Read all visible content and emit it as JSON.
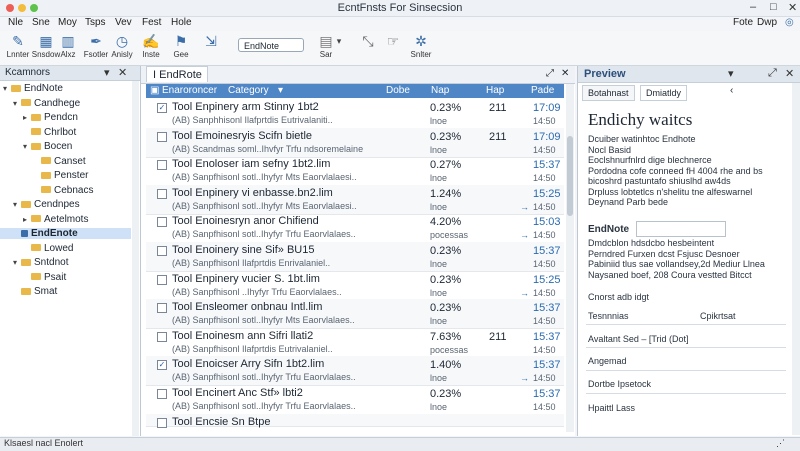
{
  "window": {
    "title": "EcntFnsts For Sinsecsion"
  },
  "menu": [
    "Nle",
    "Sne",
    "Moy",
    "Tsps",
    "Vev",
    "Fest",
    "Hole"
  ],
  "menu_right": [
    "Fote",
    "Dwp"
  ],
  "toolbar": {
    "buttons": [
      {
        "label": "Lnnter",
        "icon": "pin-icon"
      },
      {
        "label": "Snsdow",
        "icon": "grid-icon"
      },
      {
        "label": "Alxz",
        "icon": "book-icon"
      },
      {
        "label": "Fsotler",
        "icon": "pen-icon"
      },
      {
        "label": "Anisly",
        "icon": "clock-icon"
      },
      {
        "label": "Inste",
        "icon": "edit-icon"
      },
      {
        "label": "Gee",
        "icon": "flag-icon"
      }
    ],
    "select_value": "EndNote",
    "stack_label": "Sar",
    "tool_labels": [
      "",
      "Snlter"
    ]
  },
  "left_pane": {
    "title": "Kcamnors",
    "items": [
      {
        "label": "EndNote",
        "depth": 0,
        "toggle": "▾",
        "selected": false
      },
      {
        "label": "Candhege",
        "depth": 1,
        "toggle": "▾",
        "selected": false
      },
      {
        "label": "Pendcn",
        "depth": 2,
        "toggle": "▸",
        "selected": false
      },
      {
        "label": "Chrlbot",
        "depth": 2,
        "toggle": "",
        "selected": false
      },
      {
        "label": "Bocen",
        "depth": 2,
        "toggle": "▾",
        "selected": false
      },
      {
        "label": "Canset",
        "depth": 3,
        "toggle": "",
        "selected": false
      },
      {
        "label": "Penster",
        "depth": 3,
        "toggle": "",
        "selected": false
      },
      {
        "label": "Cebnacs",
        "depth": 3,
        "toggle": "",
        "selected": false
      },
      {
        "label": "Cendnpes",
        "depth": 1,
        "toggle": "▾",
        "selected": false
      },
      {
        "label": "Aetelmots",
        "depth": 2,
        "toggle": "▸",
        "selected": false
      },
      {
        "label": "EndEnote",
        "depth": 1,
        "toggle": "",
        "selected": true
      },
      {
        "label": "Lowed",
        "depth": 2,
        "toggle": "",
        "selected": false
      },
      {
        "label": "Sntdnot",
        "depth": 1,
        "toggle": "▾",
        "selected": false
      },
      {
        "label": "Psait",
        "depth": 2,
        "toggle": "",
        "selected": false
      },
      {
        "label": "Smat",
        "depth": 1,
        "toggle": "",
        "selected": false
      }
    ]
  },
  "center": {
    "tab": "I EndRote",
    "columns": [
      "Enaroroncer",
      "Category",
      "Dobe",
      "Nap",
      "Hap",
      "Pade"
    ],
    "rows": [
      {
        "checked": true,
        "title": "Tool Enpinery arm Stinny 1bt2",
        "sub": "(AB) Sanphhisonl Ilafprtdis Eutrivalaniti..",
        "pct": "0.23%",
        "status": "lnoe",
        "num": "211",
        "time": "17:09",
        "extra": "",
        "time2": "14:50"
      },
      {
        "checked": false,
        "title": "Tool Emoinesryis Scifn bietle",
        "sub": "(AB) Scandmas soml..Ihvfyr Trfu ndsoremelaine",
        "pct": "0.23%",
        "status": "lnoe",
        "num": "211",
        "time": "17:09",
        "extra": "",
        "time2": "14:50"
      },
      {
        "checked": false,
        "title": "Tool Enoloser iam sefny 1bt2.lim",
        "sub": "(AB) Sanpfhisonl sotl..Ihyfyr Mts Eaorvlalaesi..",
        "pct": "0.27%",
        "status": "lnoe",
        "num": "",
        "time": "15:37",
        "extra": "",
        "time2": "14:50"
      },
      {
        "checked": false,
        "title": "Tool Enpinery vi enbasse.bn2.lim",
        "sub": "(AB) Sanpfhisonl sotl..Ihyfyr Mts Eaorvlalaesi..",
        "pct": "1.24%",
        "status": "lnoe",
        "num": "",
        "time": "15:25",
        "extra": "→",
        "time2": "14:50"
      },
      {
        "checked": false,
        "title": "Tool Enoinesryn anor Chifiend",
        "sub": "(AB) Sanpfhisonl sotl..Ihyfyr Trfu Eaorvlalaes..",
        "pct": "4.20%",
        "status": "pocessas",
        "num": "",
        "time": "15:03",
        "extra": "→",
        "time2": "14:50"
      },
      {
        "checked": false,
        "title": "Tool Enoinery sine Sif» BU15",
        "sub": "(AB) Sanpfhisonl Ilafprtdis Enrivalaniel..",
        "pct": "0.23%",
        "status": "lnoe",
        "num": "",
        "time": "15:37",
        "extra": "",
        "time2": "14:50"
      },
      {
        "checked": false,
        "title": "Tool Enpinery vucier S. 1bt.lim",
        "sub": "(AB) Sanpfhisonl ..Ihyfyr Trfu Eaorvlalaes..",
        "pct": "0.23%",
        "status": "lnoe",
        "num": "",
        "time": "15:25",
        "extra": "→",
        "time2": "14:50"
      },
      {
        "checked": false,
        "title": "Tool Ensleomer onbnau Intl.lim",
        "sub": "(AB) Sanpfhisonl sotl..Ihyfyr Mts Eaorvlalaes..",
        "pct": "0.23%",
        "status": "lnoe",
        "num": "",
        "time": "15:37",
        "extra": "",
        "time2": "14:50"
      },
      {
        "checked": false,
        "title": "Tool Enoinesm ann Sifri llati2",
        "sub": "(AB) Sanpfhisonl Ilafprtdis Eutrivalaniel..",
        "pct": "7.63%",
        "status": "pocessas",
        "num": "211",
        "time": "15:37",
        "extra": "",
        "time2": "14:50"
      },
      {
        "checked": true,
        "title": "Tool Enoicser Arry Sifn 1bt2.lim",
        "sub": "(AB) Sanpfhisonl sotl..Ihyfyr Trfu Eaorvlalaes..",
        "pct": "1.40%",
        "status": "lnoe",
        "num": "",
        "time": "15:37",
        "extra": "→",
        "time2": "14:50"
      },
      {
        "checked": false,
        "title": "Tool Encinert Anc Stf» lbti2",
        "sub": "(AB) Sanpfhisonl sotl..Ihyfyr Trfu Eaorvlalaes..",
        "pct": "0.23%",
        "status": "lnoe",
        "num": "",
        "time": "15:37",
        "extra": "",
        "time2": "14:50"
      },
      {
        "checked": false,
        "title": "Tool Encsie Sn Btpe",
        "sub": "",
        "pct": "",
        "status": "",
        "num": "",
        "time": "",
        "extra": "",
        "time2": ""
      }
    ]
  },
  "right_pane": {
    "title": "Preview",
    "tabs": [
      "Botahnast",
      "Dmiatldy"
    ],
    "heading": "Endichy waitcs",
    "lines": [
      {
        "text": "Dcuiber watinhtoc Endhote",
        "link": false
      },
      {
        "text": "Nocl Basid",
        "link": false
      },
      {
        "text": "Eoclshnurfnlrd dige blechnerce",
        "link": false
      },
      {
        "text": "Pordodna cofe conneed fH 4004 rhe and bs",
        "link": false
      },
      {
        "text": "bicoshrd pastuntafo shiuslhd aw4ds",
        "link": false
      },
      {
        "text": "Drpluss lobtetlcs n'shelitu tne alfeswarnel",
        "link": false
      },
      {
        "text": "Deynand Parb bede",
        "link": false
      }
    ],
    "field_label": "EndNote",
    "field_lines": [
      "Dmdcblon hdsdcbo hesbeintent",
      "Perndred Furxen dcst Fsjusc Desnoer",
      "Pabiniid tlus sae vollandsey,2d Mediur Llnea",
      "Naysaned boef, 208 Coura vestted Bitcct"
    ],
    "section1": "Cnorst adb idgt",
    "pair": [
      "Tesnnnias",
      "Cpikrtsat"
    ],
    "section2": "Avaltant Sed – [Trid (Dot]",
    "section3": "Angemad",
    "section4": "Dortbe Ipsetock",
    "section5": "Hpaittl Lass"
  },
  "status": {
    "text": "Klsaesl nacl Enolert"
  },
  "colors": {
    "accent": "#4f86c6",
    "folder": "#e9b84a",
    "link": "#2a6bb0"
  }
}
